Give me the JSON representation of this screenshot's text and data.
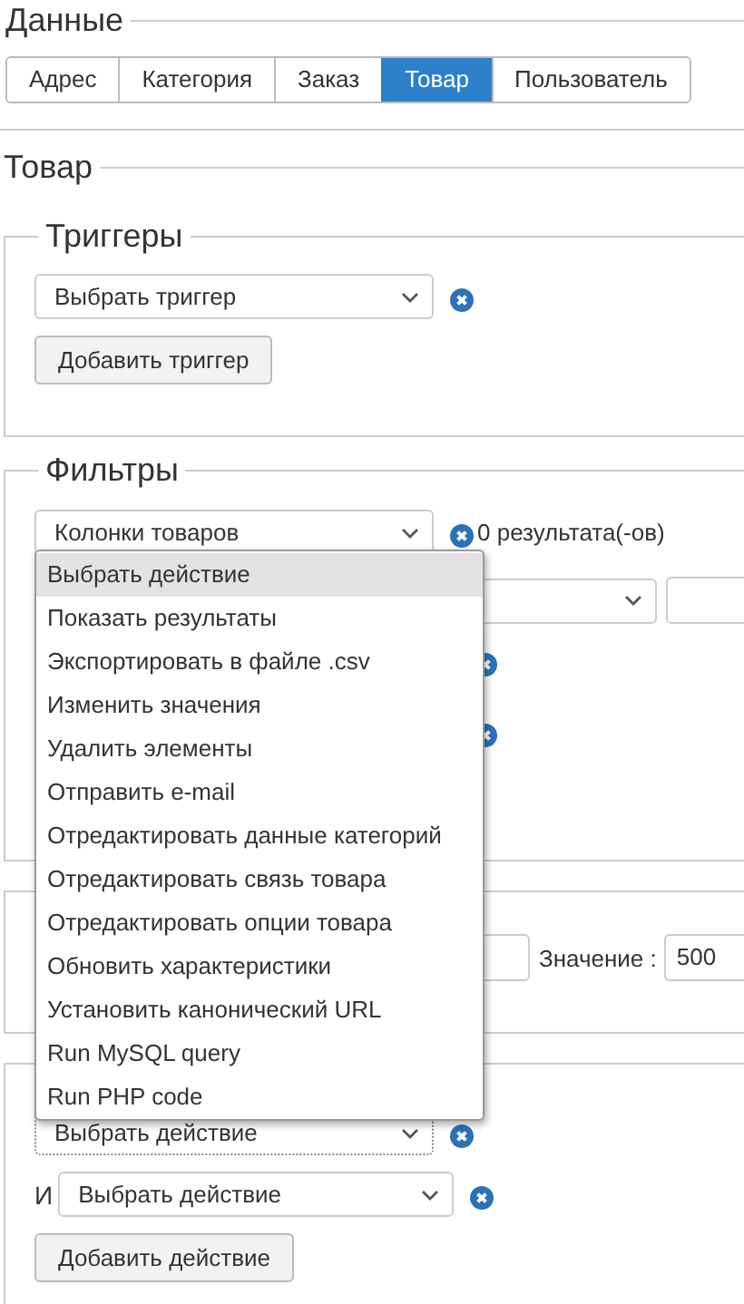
{
  "data_section": {
    "title": "Данные",
    "tabs": [
      {
        "label": "Адрес",
        "selected": false
      },
      {
        "label": "Категория",
        "selected": false
      },
      {
        "label": "Заказ",
        "selected": false
      },
      {
        "label": "Товар",
        "selected": true
      },
      {
        "label": "Пользователь",
        "selected": false
      }
    ]
  },
  "section_title": "Товар",
  "triggers": {
    "legend": "Триггеры",
    "select": "Выбрать триггер",
    "add_button": "Добавить триггер"
  },
  "filters": {
    "legend": "Фильтры",
    "column_select": "Колонки товаров",
    "result_count": "0 результата(-ов)"
  },
  "limit": {
    "value_label": "Значение :",
    "value": "500"
  },
  "actions": {
    "select": "Выбрать действие",
    "connector": "И",
    "second_select": "Выбрать действие",
    "add_button": "Добавить действие"
  },
  "action_menu": {
    "items": [
      {
        "label": "Выбрать действие",
        "selected": true
      },
      {
        "label": "Показать результаты",
        "selected": false
      },
      {
        "label": "Экспортировать в файле .csv",
        "selected": false
      },
      {
        "label": "Изменить значения",
        "selected": false
      },
      {
        "label": "Удалить элементы",
        "selected": false
      },
      {
        "label": "Отправить e-mail",
        "selected": false
      },
      {
        "label": "Отредактировать данные категорий",
        "selected": false
      },
      {
        "label": "Отредактировать связь товара",
        "selected": false
      },
      {
        "label": "Отредактировать опции товара",
        "selected": false
      },
      {
        "label": "Обновить характеристики",
        "selected": false
      },
      {
        "label": "Установить канонический URL",
        "selected": false
      },
      {
        "label": "Run MySQL query",
        "selected": false
      },
      {
        "label": "Run PHP code",
        "selected": false
      }
    ]
  }
}
